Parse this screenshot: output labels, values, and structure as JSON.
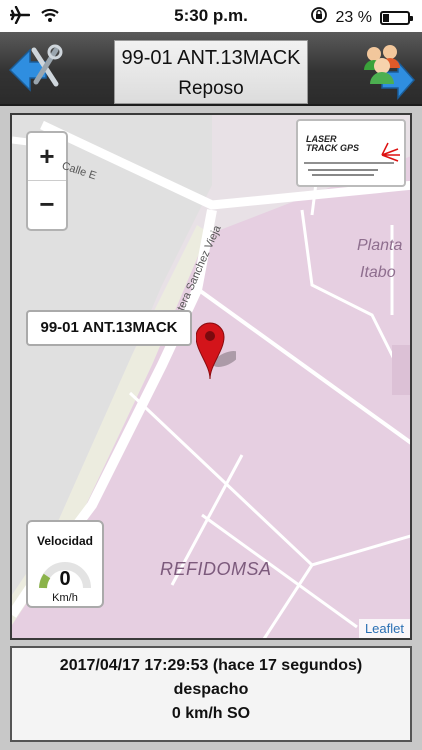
{
  "status_bar": {
    "time": "5:30 p.m.",
    "battery_text": "23 %",
    "battery_level": 0.23,
    "icons": [
      "airplane-icon",
      "wifi-icon",
      "rotation-lock-icon",
      "battery-icon"
    ]
  },
  "header": {
    "vehicle": "99-01 ANT.13MACK",
    "state": "Reposo",
    "left_icon": "tools-back-arrow-icon",
    "right_icon": "people-forward-arrow-icon"
  },
  "map": {
    "zoom_in_label": "+",
    "zoom_out_label": "−",
    "logo_text_1": "LASER",
    "logo_text_2": "TRACK GPS",
    "marker_label": "99-01 ANT.13MACK",
    "place_planta": "Planta",
    "place_itabo": "Itabo",
    "place_refidomsa": "REFIDOMSA",
    "street_calle_e": "Calle E",
    "street_vieja": "Carretera Sanchez Vieja",
    "attribution": "Leaflet",
    "speed": {
      "title": "Velocidad",
      "value": "0",
      "unit": "Km/h",
      "level": 0
    },
    "colors": {
      "land": "#e8e0e6",
      "industrial": "#e7cde0",
      "road": "#ffffff",
      "marker": "#d3141a"
    }
  },
  "footer": {
    "timestamp": "2017/04/17 17:29:53 (hace 17 segundos)",
    "place": "despacho",
    "speed_dir": "0 km/h SO"
  }
}
